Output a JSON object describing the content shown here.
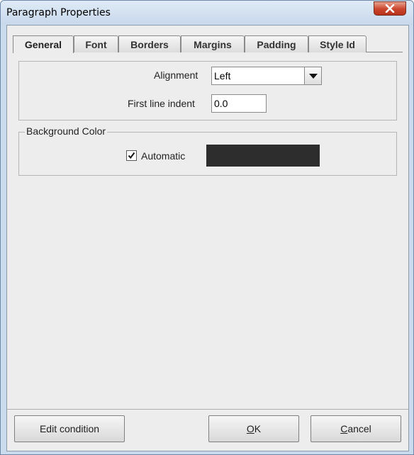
{
  "window": {
    "title": "Paragraph Properties",
    "close_icon": "close-icon"
  },
  "tabs": [
    {
      "label": "General",
      "active": true
    },
    {
      "label": "Font",
      "active": false
    },
    {
      "label": "Borders",
      "active": false
    },
    {
      "label": "Margins",
      "active": false
    },
    {
      "label": "Padding",
      "active": false
    },
    {
      "label": "Style Id",
      "active": false
    }
  ],
  "general": {
    "alignment_label": "Alignment",
    "alignment_value": "Left",
    "first_line_indent_label": "First line indent",
    "first_line_indent_value": "0.0"
  },
  "background": {
    "legend": "Background Color",
    "automatic_label": "Automatic",
    "automatic_checked": true,
    "swatch_color": "#2d2d2d"
  },
  "buttons": {
    "edit_condition": "Edit condition",
    "ok": "OK",
    "cancel": "Cancel"
  }
}
